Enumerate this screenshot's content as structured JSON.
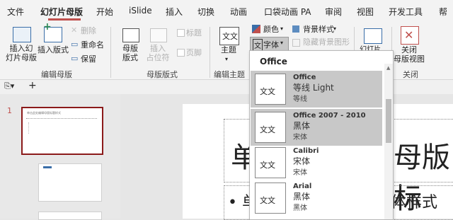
{
  "tabs": [
    "文件",
    "幻灯片母版",
    "开始",
    "iSlide",
    "插入",
    "切换",
    "动画",
    "口袋动画 PA",
    "审阅",
    "视图",
    "开发工具",
    "帮"
  ],
  "active_tab": "幻灯片母版",
  "ribbon": {
    "insert_master": "插入幻\n灯片母版",
    "insert_layout": "插入版式",
    "delete": "删除",
    "rename": "重命名",
    "preserve": "保留",
    "master_layout": "母版\n版式",
    "insert_placeholder": "插入\n占位符",
    "title_chk": "标题",
    "footer_chk": "页脚",
    "theme": "主题",
    "colors": "颜色",
    "fonts": "字体",
    "bg_styles": "背景样式",
    "hide_bg": "隐藏背景图形",
    "slide_size_partial": "幻灯片",
    "close_master": "关闭\n母版视图",
    "group_edit_master": "编辑母版",
    "group_master_layout": "母版版式",
    "group_edit_theme": "编辑主题",
    "group_close": "关闭"
  },
  "pane": {
    "slide_number": "1",
    "thumb_master_title": "单击此处编辑母版标题样式"
  },
  "canvas": {
    "title_left": "单",
    "title_right": "母版标",
    "bullet_left": "• 单",
    "bullet_right": "体样式"
  },
  "dropdown": {
    "header": "Office",
    "items": [
      {
        "preview": "文文",
        "latin": "Office",
        "cjk_heading": "等线 Light",
        "cjk_body": "等线"
      },
      {
        "preview": "文文",
        "latin": "Office 2007 - 2010",
        "cjk_heading": "黑体",
        "cjk_body": "宋体"
      },
      {
        "preview": "文文",
        "latin": "Calibri",
        "cjk_heading": "宋体",
        "cjk_body": "宋体"
      },
      {
        "preview": "文文",
        "latin": "Arial",
        "cjk_heading": "黑体",
        "cjk_body": "黑体"
      }
    ]
  },
  "colors": {
    "accent": "#c0504d",
    "selection": "#c8c8c8",
    "border_selected": "#8b1a1a"
  }
}
